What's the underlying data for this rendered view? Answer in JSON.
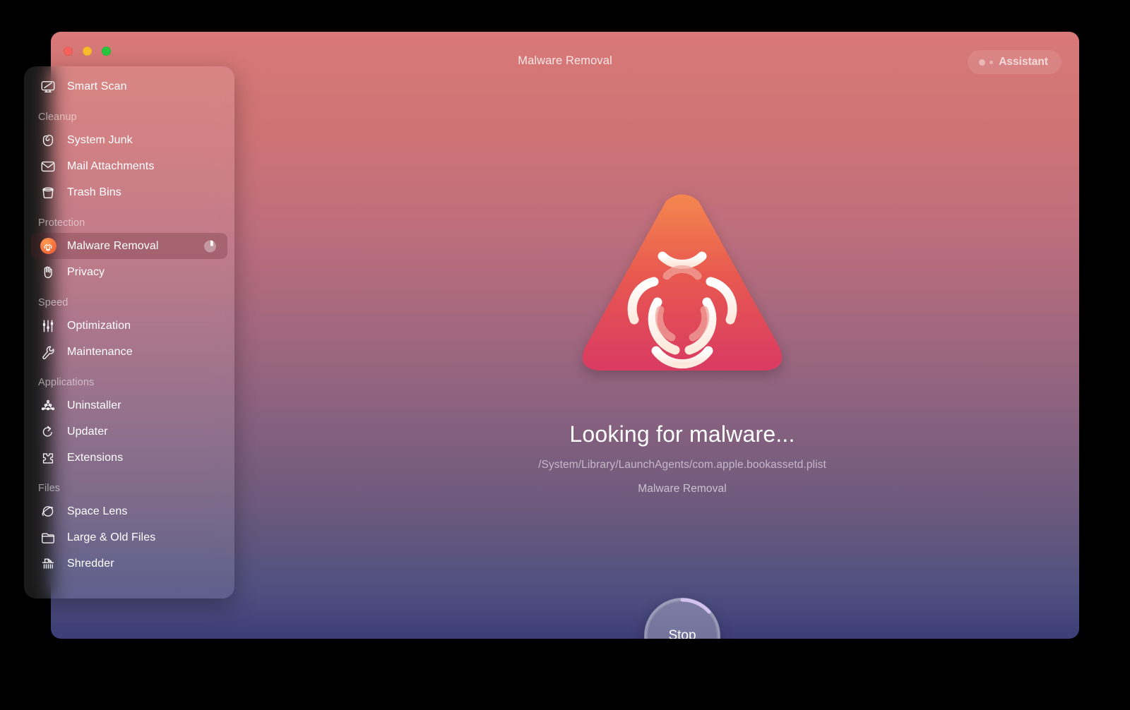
{
  "window": {
    "title": "Malware Removal",
    "traffic_lights": [
      "close",
      "minimize",
      "maximize"
    ],
    "accent_top_color": "#d87977",
    "accent_bottom_color": "#3d3d77"
  },
  "assistant": {
    "label": "Assistant"
  },
  "sidebar": {
    "groups": [
      {
        "section": null,
        "items": [
          {
            "label": "Smart Scan",
            "icon": "monitor-scan-icon",
            "selected": false
          }
        ]
      },
      {
        "section": "Cleanup",
        "items": [
          {
            "label": "System Junk",
            "icon": "broom-bag-icon",
            "selected": false
          },
          {
            "label": "Mail Attachments",
            "icon": "envelope-icon",
            "selected": false
          },
          {
            "label": "Trash Bins",
            "icon": "trash-bin-icon",
            "selected": false
          }
        ]
      },
      {
        "section": "Protection",
        "items": [
          {
            "label": "Malware Removal",
            "icon": "biohazard-icon",
            "selected": true,
            "progress": true
          },
          {
            "label": "Privacy",
            "icon": "hand-icon",
            "selected": false
          }
        ]
      },
      {
        "section": "Speed",
        "items": [
          {
            "label": "Optimization",
            "icon": "sliders-icon",
            "selected": false
          },
          {
            "label": "Maintenance",
            "icon": "wrench-icon",
            "selected": false
          }
        ]
      },
      {
        "section": "Applications",
        "items": [
          {
            "label": "Uninstaller",
            "icon": "molecule-icon",
            "selected": false
          },
          {
            "label": "Updater",
            "icon": "refresh-arrow-icon",
            "selected": false
          },
          {
            "label": "Extensions",
            "icon": "puzzle-piece-icon",
            "selected": false
          }
        ]
      },
      {
        "section": "Files",
        "items": [
          {
            "label": "Space Lens",
            "icon": "planet-icon",
            "selected": false
          },
          {
            "label": "Large & Old Files",
            "icon": "folder-icon",
            "selected": false
          },
          {
            "label": "Shredder",
            "icon": "shredder-icon",
            "selected": false
          }
        ]
      }
    ]
  },
  "main": {
    "hero_icon": "biohazard-triangle-icon",
    "status_title": "Looking for malware...",
    "status_path": "/System/Library/LaunchAgents/com.apple.bookassetd.plist",
    "status_module": "Malware Removal",
    "stop_button_label": "Stop"
  }
}
